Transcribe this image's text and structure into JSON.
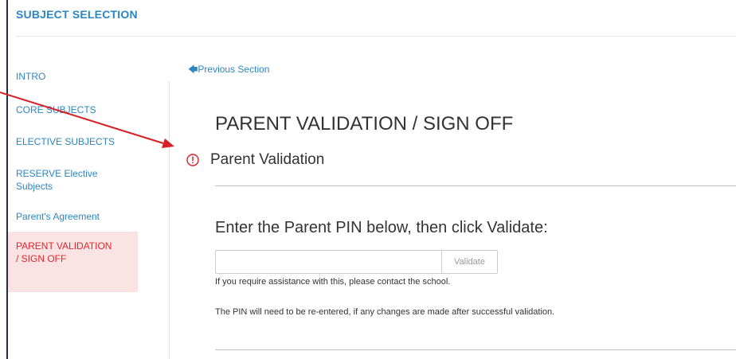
{
  "header": {
    "title": "SUBJECT SELECTION"
  },
  "sidebar": {
    "items": [
      {
        "label": "INTRO"
      },
      {
        "label": "CORE SUBJECTS"
      },
      {
        "label": "ELECTIVE SUBJECTS"
      },
      {
        "label": "RESERVE Elective Subjects"
      },
      {
        "label": "Parent's Agreement"
      },
      {
        "label": "PARENT VALIDATION / SIGN OFF",
        "active": true
      }
    ]
  },
  "nav": {
    "previous_label": "Previous Section",
    "previous_icon": "arrow-left-icon"
  },
  "main": {
    "title": "PARENT VALIDATION / SIGN OFF",
    "section_title": "Parent Validation",
    "status_icon": "warning-circle-icon",
    "pin_prompt": "Enter the Parent PIN below, then click Validate:",
    "pin_value": "",
    "pin_placeholder": "",
    "validate_label": "Validate",
    "help_text": "If you require assistance with this, please contact the school.",
    "reentry_text": "The PIN will need to be re-entered, if any changes are made after successful validation."
  },
  "colors": {
    "accent": "#2d86c4",
    "active_text": "#e0272d",
    "active_bg": "#fbe3e4",
    "annotation_arrow": "#d61f26"
  }
}
